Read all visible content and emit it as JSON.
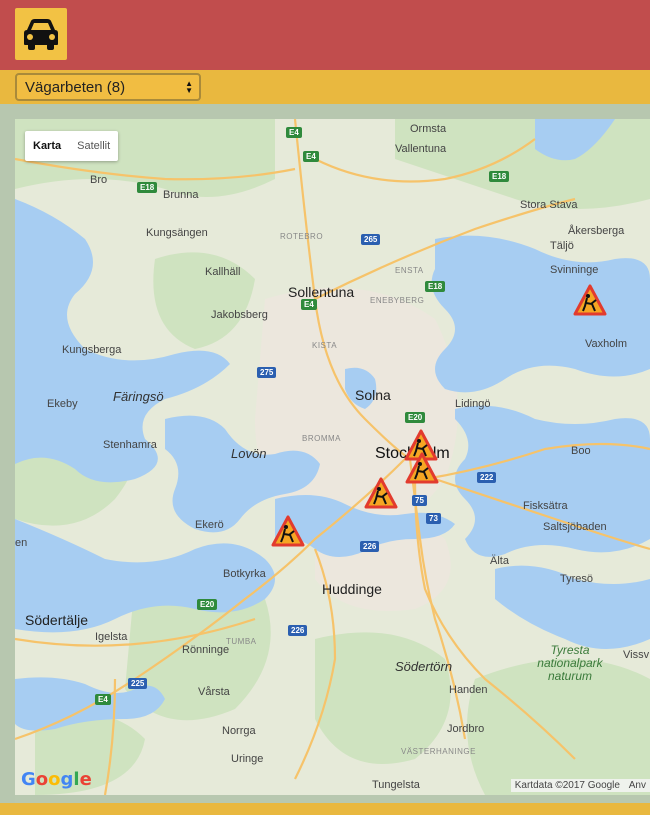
{
  "header": {
    "logo_icon": "car-icon"
  },
  "toolbar": {
    "select_value": "Vägarbeten (8)"
  },
  "map": {
    "type_control": {
      "map_label": "Karta",
      "satellite_label": "Satellit"
    },
    "attribution": "Kartdata ©2017 Google",
    "attribution_extra": "Anv",
    "places": {
      "ormsta": "Ormsta",
      "vallentuna": "Vallentuna",
      "bro": "Bro",
      "brunna": "Brunna",
      "stora_stava": "Stora Stava",
      "akersberga": "Åkersberga",
      "kungsangen": "Kungsängen",
      "rotebro": "ROTEBRO",
      "taljo": "Täljö",
      "kallhall": "Kallhäll",
      "ensta": "ENSTA",
      "svinninge": "Svinninge",
      "sollentuna": "Sollentuna",
      "enebyberg": "ENEBYBERG",
      "jakobsberg": "Jakobsberg",
      "vaxholm": "Vaxholm",
      "kungsberga": "Kungsberga",
      "kista": "KISTA",
      "solna": "Solna",
      "ekeby": "Ekeby",
      "faringso": "Färingsö",
      "lidingo": "Lidingö",
      "bromma": "BROMMA",
      "stenhamra": "Stenhamra",
      "lovon": "Lovön",
      "stockholm": "Stockholm",
      "boo": "Boo",
      "fisksatra": "Fisksätra",
      "ekero": "Ekerö",
      "saltsjobaden": "Saltsjöbaden",
      "alta": "Älta",
      "botkyrka": "Botkyrka",
      "huddinge": "Huddinge",
      "tyreso": "Tyresö",
      "sodertalje": "Södertälje",
      "tumba": "TUMBA",
      "igelsta": "Igelsta",
      "ronninge": "Rönninge",
      "sodertorn": "Södertörn",
      "tyresta": "Tyresta nationalpark naturum",
      "vissv": "Vissv",
      "handen": "Handen",
      "varsta": "Vårsta",
      "jordbro": "Jordbro",
      "norrga": "Norrga",
      "vasterhaninge": "VÄSTERHANINGE",
      "uringe": "Uringe",
      "tungelsta": "Tungelsta",
      "en": "en"
    },
    "roads": {
      "e4a": "E4",
      "e4b": "E4",
      "e4c": "E4",
      "e18a": "E18",
      "e18b": "E18",
      "e18c": "E18",
      "r265": "265",
      "r275": "275",
      "e20a": "E20",
      "e20b": "E20",
      "r222": "222",
      "r75": "75",
      "r73": "73",
      "r226a": "226",
      "r226b": "226",
      "r225": "225",
      "e4d": "E4"
    },
    "markers_icon": "roadwork-warning-icon"
  }
}
